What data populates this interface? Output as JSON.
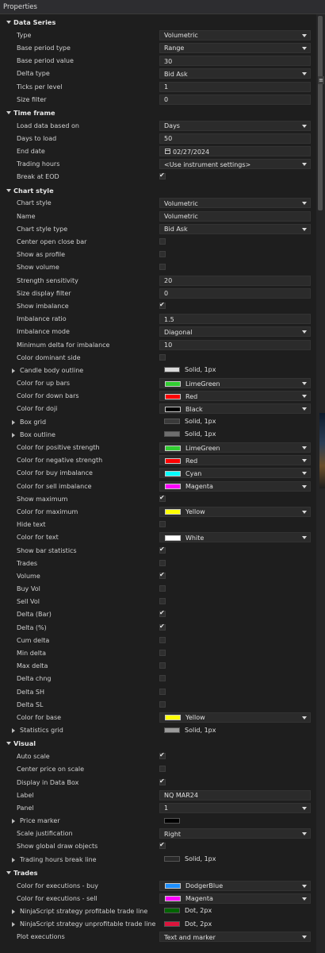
{
  "window": {
    "title": "Properties"
  },
  "edge_marker": "≡",
  "sections": [
    {
      "name": "Data Series",
      "items": [
        {
          "label": "Type",
          "kind": "dropdown",
          "value": "Volumetric"
        },
        {
          "label": "Base period type",
          "kind": "dropdown",
          "value": "Range"
        },
        {
          "label": "Base period value",
          "kind": "text",
          "value": "30"
        },
        {
          "label": "Delta type",
          "kind": "dropdown",
          "value": "Bid Ask"
        },
        {
          "label": "Ticks per level",
          "kind": "text",
          "value": "1"
        },
        {
          "label": "Size filter",
          "kind": "text",
          "value": "0"
        }
      ]
    },
    {
      "name": "Time frame",
      "items": [
        {
          "label": "Load data based on",
          "kind": "dropdown",
          "value": "Days"
        },
        {
          "label": "Days to load",
          "kind": "text",
          "value": "50"
        },
        {
          "label": "End date",
          "kind": "date",
          "value": "02/27/2024",
          "icon": "calendar-icon"
        },
        {
          "label": "Trading hours",
          "kind": "dropdown",
          "value": "<Use instrument settings>"
        },
        {
          "label": "Break at EOD",
          "kind": "check",
          "checked": true
        }
      ]
    },
    {
      "name": "Chart style",
      "items": [
        {
          "label": "Chart style",
          "kind": "dropdown",
          "value": "Volumetric"
        },
        {
          "label": "Name",
          "kind": "text",
          "value": "Volumetric"
        },
        {
          "label": "Chart style type",
          "kind": "dropdown",
          "value": "Bid Ask"
        },
        {
          "label": "Center open close bar",
          "kind": "check",
          "checked": false
        },
        {
          "label": "Show as profile",
          "kind": "check",
          "checked": false
        },
        {
          "label": "Show volume",
          "kind": "check",
          "checked": false
        },
        {
          "label": "Strength sensitivity",
          "kind": "text",
          "value": "20"
        },
        {
          "label": "Size display filter",
          "kind": "text",
          "value": "0"
        },
        {
          "label": "Show imbalance",
          "kind": "check",
          "checked": true
        },
        {
          "label": "Imbalance ratio",
          "kind": "text",
          "value": "1.5"
        },
        {
          "label": "Imbalance mode",
          "kind": "dropdown",
          "value": "Diagonal"
        },
        {
          "label": "Minimum delta for imbalance",
          "kind": "text",
          "value": "10"
        },
        {
          "label": "Color dominant side",
          "kind": "check",
          "checked": false
        },
        {
          "label": "Candle body outline",
          "kind": "stroke",
          "value": "Solid, 1px",
          "color": "#d9d9d9",
          "expandable": true
        },
        {
          "label": "Color for up bars",
          "kind": "color",
          "value": "LimeGreen",
          "color": "#32cd32"
        },
        {
          "label": "Color for down bars",
          "kind": "color",
          "value": "Red",
          "color": "#ff0000"
        },
        {
          "label": "Color for doji",
          "kind": "color",
          "value": "Black",
          "color": "#000000"
        },
        {
          "label": "Box grid",
          "kind": "stroke",
          "value": "Solid, 1px",
          "color": "#3a3a3a",
          "expandable": true
        },
        {
          "label": "Box outline",
          "kind": "stroke",
          "value": "Solid, 1px",
          "color": "#6e6e6e",
          "expandable": true
        },
        {
          "label": "Color for positive strength",
          "kind": "color",
          "value": "LimeGreen",
          "color": "#32cd32"
        },
        {
          "label": "Color for negative strength",
          "kind": "color",
          "value": "Red",
          "color": "#ff0000"
        },
        {
          "label": "Color for buy imbalance",
          "kind": "color",
          "value": "Cyan",
          "color": "#00ffff"
        },
        {
          "label": "Color for sell imbalance",
          "kind": "color",
          "value": "Magenta",
          "color": "#ff00ff"
        },
        {
          "label": "Show maximum",
          "kind": "check",
          "checked": true
        },
        {
          "label": "Color for maximum",
          "kind": "color",
          "value": "Yellow",
          "color": "#ffff00"
        },
        {
          "label": "Hide text",
          "kind": "check",
          "checked": false
        },
        {
          "label": "Color for text",
          "kind": "color",
          "value": "White",
          "color": "#ffffff"
        },
        {
          "label": "Show bar statistics",
          "kind": "check",
          "checked": true
        },
        {
          "label": "Trades",
          "kind": "check",
          "checked": false
        },
        {
          "label": "Volume",
          "kind": "check",
          "checked": true
        },
        {
          "label": "Buy Vol",
          "kind": "check",
          "checked": false
        },
        {
          "label": "Sell Vol",
          "kind": "check",
          "checked": false
        },
        {
          "label": "Delta (Bar)",
          "kind": "check",
          "checked": true
        },
        {
          "label": "Delta (%)",
          "kind": "check",
          "checked": true
        },
        {
          "label": "Cum delta",
          "kind": "check",
          "checked": false
        },
        {
          "label": "Min delta",
          "kind": "check",
          "checked": false
        },
        {
          "label": "Max delta",
          "kind": "check",
          "checked": false
        },
        {
          "label": "Delta chng",
          "kind": "check",
          "checked": false
        },
        {
          "label": "Delta SH",
          "kind": "check",
          "checked": false
        },
        {
          "label": "Delta SL",
          "kind": "check",
          "checked": false
        },
        {
          "label": "Color for base",
          "kind": "color",
          "value": "Yellow",
          "color": "#ffff00"
        },
        {
          "label": "Statistics grid",
          "kind": "stroke",
          "value": "Solid, 1px",
          "color": "#9a9a9a",
          "expandable": true
        }
      ]
    },
    {
      "name": "Visual",
      "items": [
        {
          "label": "Auto scale",
          "kind": "check",
          "checked": true
        },
        {
          "label": "Center price on scale",
          "kind": "check",
          "checked": false
        },
        {
          "label": "Display in Data Box",
          "kind": "check",
          "checked": true
        },
        {
          "label": "Label",
          "kind": "text",
          "value": "NQ MAR24"
        },
        {
          "label": "Panel",
          "kind": "dropdown",
          "value": "1"
        },
        {
          "label": "Price marker",
          "kind": "stroke",
          "value": "",
          "color": "#000000",
          "expandable": true
        },
        {
          "label": "Scale justification",
          "kind": "dropdown",
          "value": "Right"
        },
        {
          "label": "Show global draw objects",
          "kind": "check",
          "checked": true
        },
        {
          "label": "Trading hours break line",
          "kind": "stroke",
          "value": "Solid, 1px",
          "color": "#2a2a2a",
          "expandable": true
        }
      ]
    },
    {
      "name": "Trades",
      "items": [
        {
          "label": "Color for executions - buy",
          "kind": "color",
          "value": "DodgerBlue",
          "color": "#1e90ff"
        },
        {
          "label": "Color for executions - sell",
          "kind": "color",
          "value": "Magenta",
          "color": "#ff00ff"
        },
        {
          "label": "NinjaScript strategy profitable trade line",
          "kind": "stroke",
          "value": "Dot, 2px",
          "color": "#006400",
          "expandable": true
        },
        {
          "label": "NinjaScript strategy unprofitable trade line",
          "kind": "stroke",
          "value": "Dot, 2px",
          "color": "#dc143c",
          "expandable": true
        },
        {
          "label": "Plot executions",
          "kind": "dropdown",
          "value": "Text and marker"
        }
      ]
    }
  ]
}
